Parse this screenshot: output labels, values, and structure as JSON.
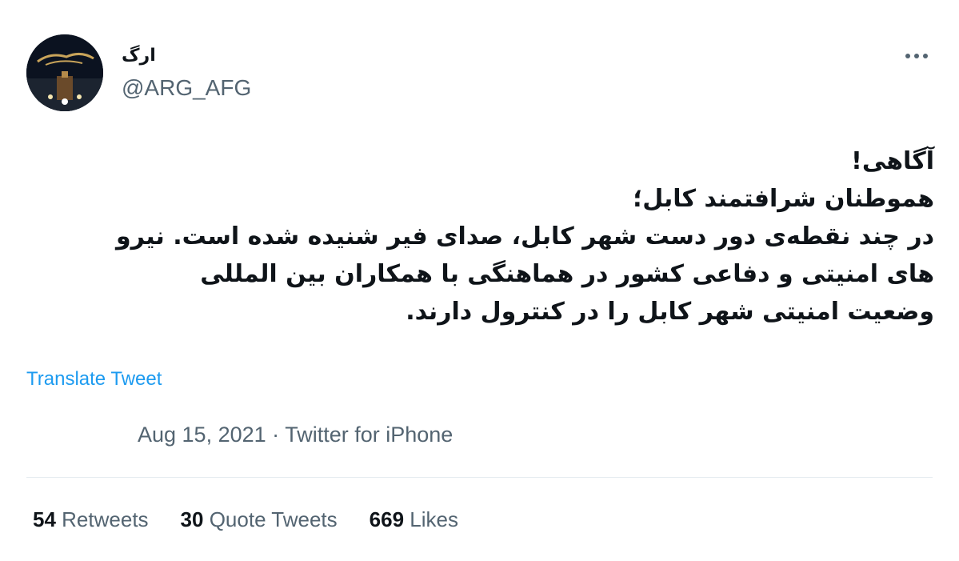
{
  "tweet": {
    "display_name": "ارگ",
    "handle": "@ARG_AFG",
    "more_icon": "more-horizontal-icon",
    "text_lines": [
      "آگاهی!",
      "هموطنان شرافتمند کابل؛",
      "در چند نقطه‌ی دور دست شهر کابل، صدای  فیر شنیده شده است. نیرو",
      "های امنیتی و دفاعی کشور در هماهنگی با همکاران بین المللی",
      "وضعیت امنیتی شهر کابل را  در کنترول دارند."
    ],
    "translate_label": "Translate Tweet",
    "date": "Aug 15, 2021",
    "separator": "·",
    "source": "Twitter for iPhone"
  },
  "stats": {
    "retweets_count": "54",
    "retweets_label": "Retweets",
    "quote_count": "30",
    "quote_label": "Quote Tweets",
    "likes_count": "669",
    "likes_label": "Likes"
  },
  "colors": {
    "link": "#1d9bf0",
    "secondary_text": "#536471",
    "primary_text": "#0f1419",
    "divider": "#e6ecf0"
  }
}
